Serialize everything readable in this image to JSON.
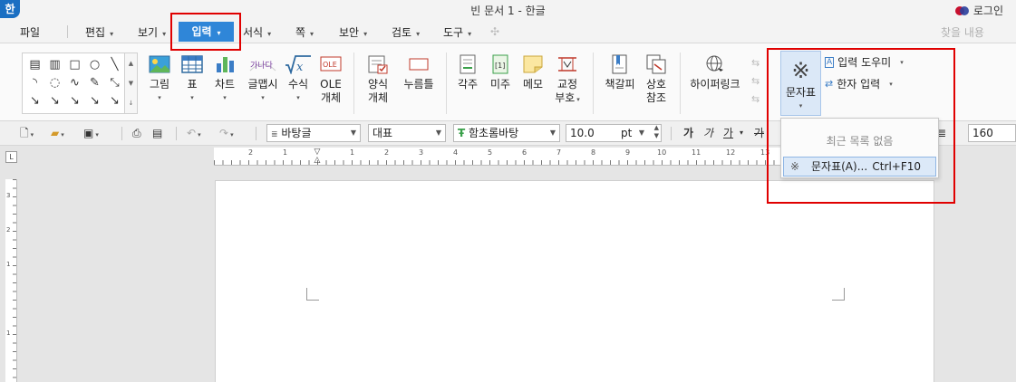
{
  "window": {
    "app_icon": "한",
    "title": "빈 문서 1 - 한글",
    "login_label": "로그인"
  },
  "menubar": {
    "items": [
      {
        "label": "파일",
        "has_caret": false
      },
      {
        "label": "편집",
        "has_caret": true
      },
      {
        "label": "보기",
        "has_caret": true
      },
      {
        "label": "입력",
        "has_caret": true,
        "active": true
      },
      {
        "label": "서식",
        "has_caret": true
      },
      {
        "label": "쪽",
        "has_caret": true
      },
      {
        "label": "보안",
        "has_caret": true
      },
      {
        "label": "검토",
        "has_caret": true
      },
      {
        "label": "도구",
        "has_caret": true
      }
    ],
    "search_label": "찾을 내용"
  },
  "ribbon": {
    "buttons": [
      {
        "label": "그림",
        "icon": "picture-icon"
      },
      {
        "label": "표",
        "icon": "table-icon"
      },
      {
        "label": "차트",
        "icon": "chart-icon"
      },
      {
        "label": "글맵시",
        "icon": "wordart-icon"
      },
      {
        "label": "수식",
        "icon": "formula-icon"
      },
      {
        "label": "OLE\n개체",
        "icon": "ole-icon"
      },
      {
        "label": "양식\n개체",
        "icon": "form-icon"
      },
      {
        "label": "누름틀",
        "icon": "field-icon"
      },
      {
        "label": "각주",
        "icon": "footnote-icon"
      },
      {
        "label": "미주",
        "icon": "endnote-icon"
      },
      {
        "label": "메모",
        "icon": "memo-icon"
      },
      {
        "label": "교정\n부호",
        "icon": "proof-mark-icon"
      },
      {
        "label": "책갈피",
        "icon": "bookmark-icon"
      },
      {
        "label": "상호\n참조",
        "icon": "cross-ref-icon"
      },
      {
        "label": "하이퍼링크",
        "icon": "hyperlink-icon"
      }
    ],
    "munja_label": "문자표",
    "input_helper_label": "입력 도우미",
    "hanja_input_label": "한자 입력",
    "ole_icon_text": "OLE",
    "wordart_icon_text": "가나다"
  },
  "toolbar": {
    "style_value": "바탕글",
    "script_value": "대표",
    "font_value": "함초롬바탕",
    "size_value": "10.0",
    "size_unit": "pt",
    "bold": "가",
    "italic": "가",
    "underline": "가",
    "strike": "가",
    "zoom_value": "160"
  },
  "ruler": {
    "h_numbers": [
      "2",
      "1",
      "1",
      "2",
      "3",
      "4",
      "5",
      "6",
      "7",
      "8",
      "9",
      "10",
      "11",
      "12",
      "13"
    ],
    "v_numbers": [
      "3",
      "2",
      "1",
      "1"
    ],
    "corner_label": "L"
  },
  "dropdown": {
    "empty_text": "최근 목록 없음",
    "item_label": "문자표(A)...",
    "item_shortcut": "Ctrl+F10",
    "item_icon": "※"
  },
  "colors": {
    "accent": "#2f86d8",
    "highlight": "#e00000",
    "selected_bg": "#dce9f8"
  }
}
